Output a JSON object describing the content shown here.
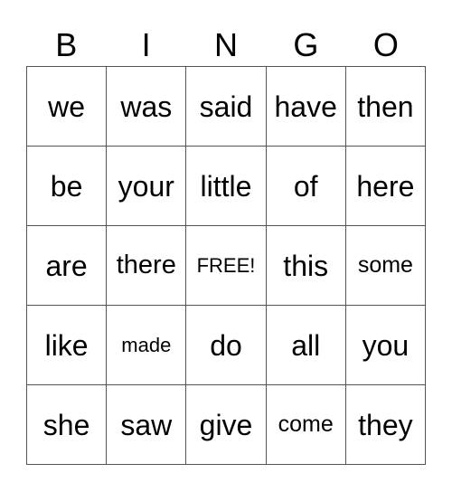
{
  "card": {
    "header": [
      "B",
      "I",
      "N",
      "G",
      "O"
    ],
    "rows": [
      [
        "we",
        "was",
        "said",
        "have",
        "then"
      ],
      [
        "be",
        "your",
        "little",
        "of",
        "here"
      ],
      [
        "are",
        "there",
        "FREE!",
        "this",
        "some"
      ],
      [
        "like",
        "made",
        "do",
        "all",
        "you"
      ],
      [
        "she",
        "saw",
        "give",
        "come",
        "they"
      ]
    ]
  }
}
